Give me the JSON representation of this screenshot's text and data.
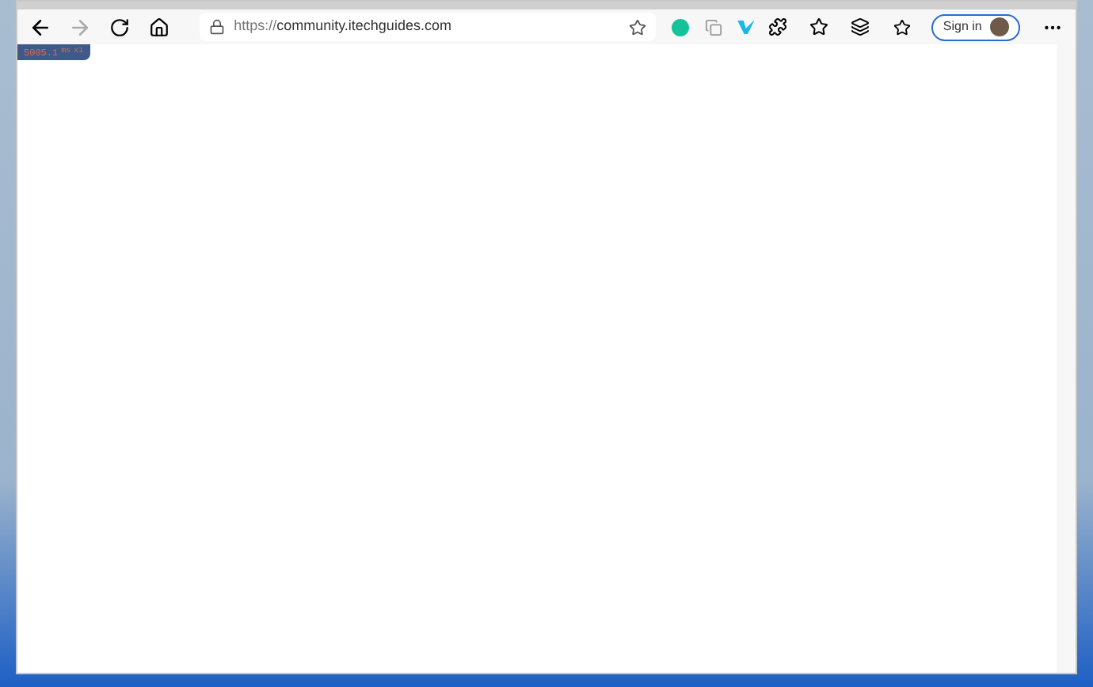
{
  "address_bar": {
    "url_prefix": "https://",
    "url_host": "community.itechguides.com"
  },
  "profile": {
    "label": "Sign in"
  },
  "timing_badge": {
    "value": "5005.1",
    "unit": "ms",
    "count": "x1"
  }
}
